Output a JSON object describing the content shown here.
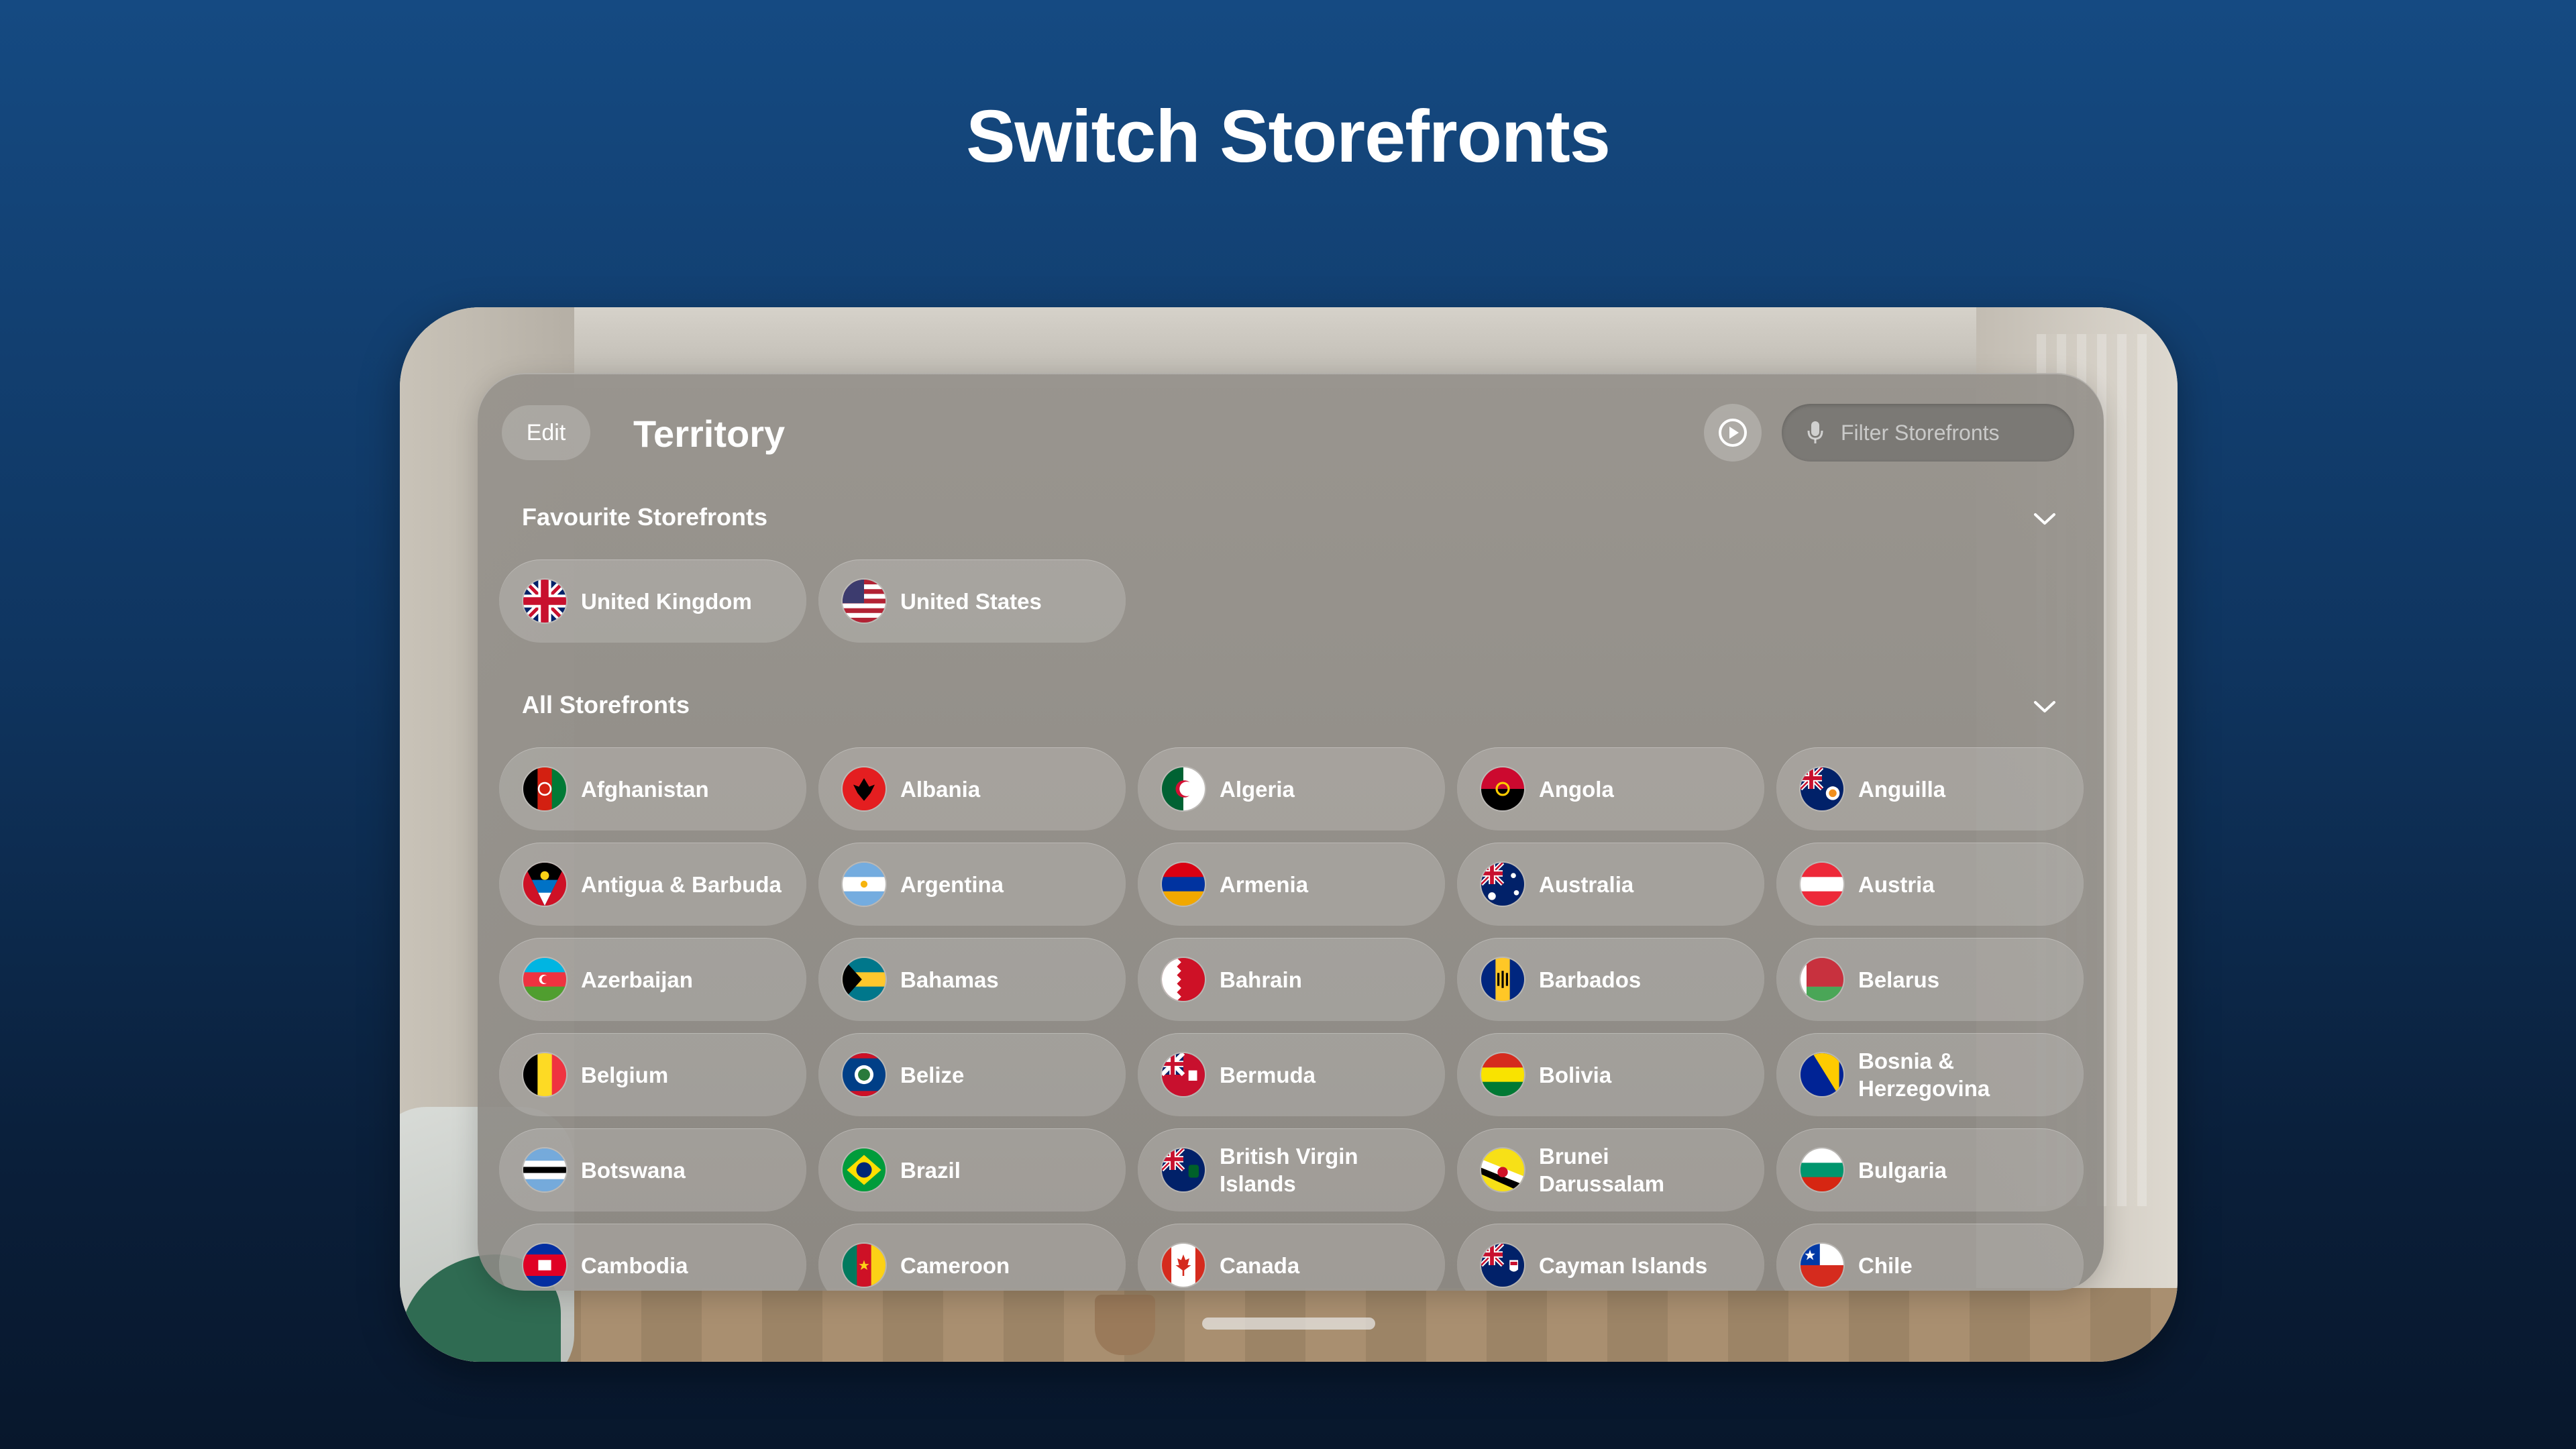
{
  "headline": "Switch Storefronts",
  "window": {
    "edit_label": "Edit",
    "title": "Territory",
    "search_placeholder": "Filter Storefronts",
    "favourites_label": "Favourite Storefronts",
    "all_label": "All Storefronts"
  },
  "favourites": [
    {
      "name": "United Kingdom",
      "flag": "uk"
    },
    {
      "name": "United States",
      "flag": "us"
    }
  ],
  "storefronts": [
    {
      "name": "Afghanistan",
      "flag": "af"
    },
    {
      "name": "Albania",
      "flag": "al"
    },
    {
      "name": "Algeria",
      "flag": "dz"
    },
    {
      "name": "Angola",
      "flag": "ao"
    },
    {
      "name": "Anguilla",
      "flag": "ai"
    },
    {
      "name": "Antigua & Barbuda",
      "flag": "ag"
    },
    {
      "name": "Argentina",
      "flag": "ar"
    },
    {
      "name": "Armenia",
      "flag": "am"
    },
    {
      "name": "Australia",
      "flag": "au"
    },
    {
      "name": "Austria",
      "flag": "at"
    },
    {
      "name": "Azerbaijan",
      "flag": "az"
    },
    {
      "name": "Bahamas",
      "flag": "bs"
    },
    {
      "name": "Bahrain",
      "flag": "bh"
    },
    {
      "name": "Barbados",
      "flag": "bb"
    },
    {
      "name": "Belarus",
      "flag": "by"
    },
    {
      "name": "Belgium",
      "flag": "be"
    },
    {
      "name": "Belize",
      "flag": "bz"
    },
    {
      "name": "Bermuda",
      "flag": "bm"
    },
    {
      "name": "Bolivia",
      "flag": "bo"
    },
    {
      "name": "Bosnia & Herzegovina",
      "flag": "ba"
    },
    {
      "name": "Botswana",
      "flag": "bw"
    },
    {
      "name": "Brazil",
      "flag": "br"
    },
    {
      "name": "British Virgin Islands",
      "flag": "vg"
    },
    {
      "name": "Brunei Darussalam",
      "flag": "bn"
    },
    {
      "name": "Bulgaria",
      "flag": "bg"
    },
    {
      "name": "Cambodia",
      "flag": "kh"
    },
    {
      "name": "Cameroon",
      "flag": "cm"
    },
    {
      "name": "Canada",
      "flag": "ca"
    },
    {
      "name": "Cayman Islands",
      "flag": "ky"
    },
    {
      "name": "Chile",
      "flag": "cl"
    }
  ]
}
